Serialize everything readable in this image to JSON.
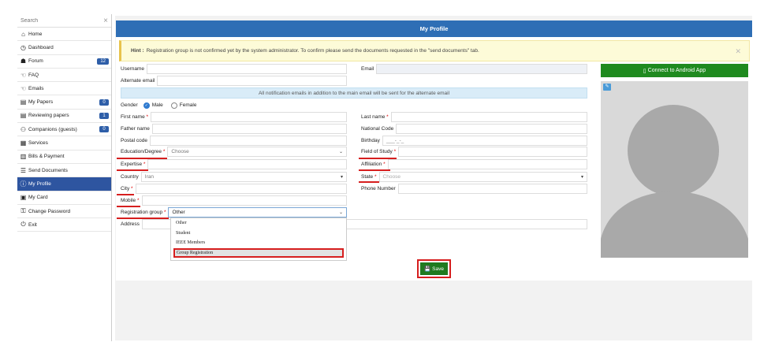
{
  "sidebar": {
    "search_placeholder": "Search",
    "items": [
      {
        "icon": "home-icon",
        "glyph": "⌂",
        "label": "Home"
      },
      {
        "icon": "dashboard-icon",
        "glyph": "◷",
        "label": "Dashboard"
      },
      {
        "icon": "forum-icon",
        "glyph": "☗",
        "label": "Forum",
        "badge": "12"
      },
      {
        "icon": "faq-icon",
        "glyph": "☜",
        "label": "FAQ"
      },
      {
        "icon": "emails-icon",
        "glyph": "☜",
        "label": "Emails"
      },
      {
        "icon": "papers-icon",
        "glyph": "▤",
        "label": "My Papers",
        "badge": "0"
      },
      {
        "icon": "reviewing-icon",
        "glyph": "▤",
        "label": "Reviewing papers",
        "badge": "1"
      },
      {
        "icon": "companions-icon",
        "glyph": "⚇",
        "label": "Companions (guests)",
        "badge": "0"
      },
      {
        "icon": "services-icon",
        "glyph": "▦",
        "label": "Services"
      },
      {
        "icon": "bills-icon",
        "glyph": "▥",
        "label": "Bills & Payment"
      },
      {
        "icon": "send-documents-icon",
        "glyph": "☰",
        "label": "Send Documents"
      },
      {
        "icon": "profile-icon",
        "glyph": "ⓘ",
        "label": "My Profile",
        "active": true
      },
      {
        "icon": "card-icon",
        "glyph": "▣",
        "label": "My Card"
      },
      {
        "icon": "password-icon",
        "glyph": "⚿",
        "label": "Change Password"
      },
      {
        "icon": "exit-icon",
        "glyph": "⏻",
        "label": "Exit"
      }
    ]
  },
  "panel": {
    "title": "My Profile",
    "hint_prefix": "Hint :",
    "hint_text": "Registration group is not confirmed yet by the system administrator. To confirm please send the documents requested in the \"send documents\" tab.",
    "notice": "All notification emails in addition to the main email will be sent for the alternate email"
  },
  "form": {
    "username_label": "Username",
    "email_label": "Email",
    "alt_email_label": "Alternate email",
    "gender_label": "Gender",
    "gender_male": "Male",
    "gender_female": "Female",
    "first_name_label": "First name",
    "last_name_label": "Last name",
    "father_name_label": "Father name",
    "national_code_label": "National Code",
    "postal_code_label": "Postal code",
    "birthday_label": "Birthday",
    "birthday_value": "___-_-_",
    "education_label": "Education/Degree",
    "education_value": "Choose",
    "field_of_study_label": "Field of Study",
    "expertise_label": "Expertise",
    "affiliation_label": "Affiliation",
    "country_label": "Country",
    "country_value": "Iran",
    "state_label": "State",
    "state_value": "Choose",
    "city_label": "City",
    "phone_label": "Phone Number",
    "mobile_label": "Mobile",
    "reg_group_label": "Registration group",
    "reg_group_value": "Other",
    "address_label": "Address",
    "required_mark": "*"
  },
  "dropdown": {
    "options": [
      "Other",
      "Student",
      "IEEE Members",
      "Group Registration"
    ]
  },
  "buttons": {
    "save": "Save",
    "android": "Connect to Android App"
  }
}
